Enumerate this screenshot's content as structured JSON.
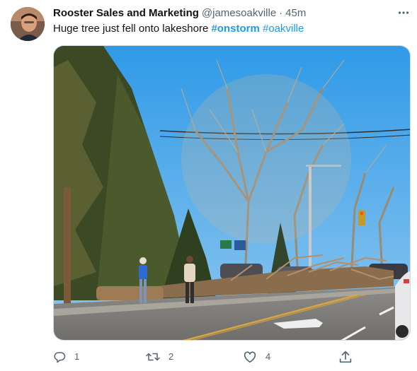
{
  "author": {
    "name": "Rooster Sales and Marketing",
    "handle": "@jamesoakville",
    "separator": "·",
    "timestamp": "45m"
  },
  "tweet": {
    "text_prefix": "Huge tree just fell onto lakeshore ",
    "hashtags": [
      "#onstorm",
      "#oakville"
    ]
  },
  "media": {
    "description_icon": "photo"
  },
  "actions": {
    "reply_count": "1",
    "retweet_count": "2",
    "like_count": "4"
  },
  "colors": {
    "accent": "#1d9bf0",
    "secondary_text": "#536471",
    "primary_text": "#0f1419"
  }
}
